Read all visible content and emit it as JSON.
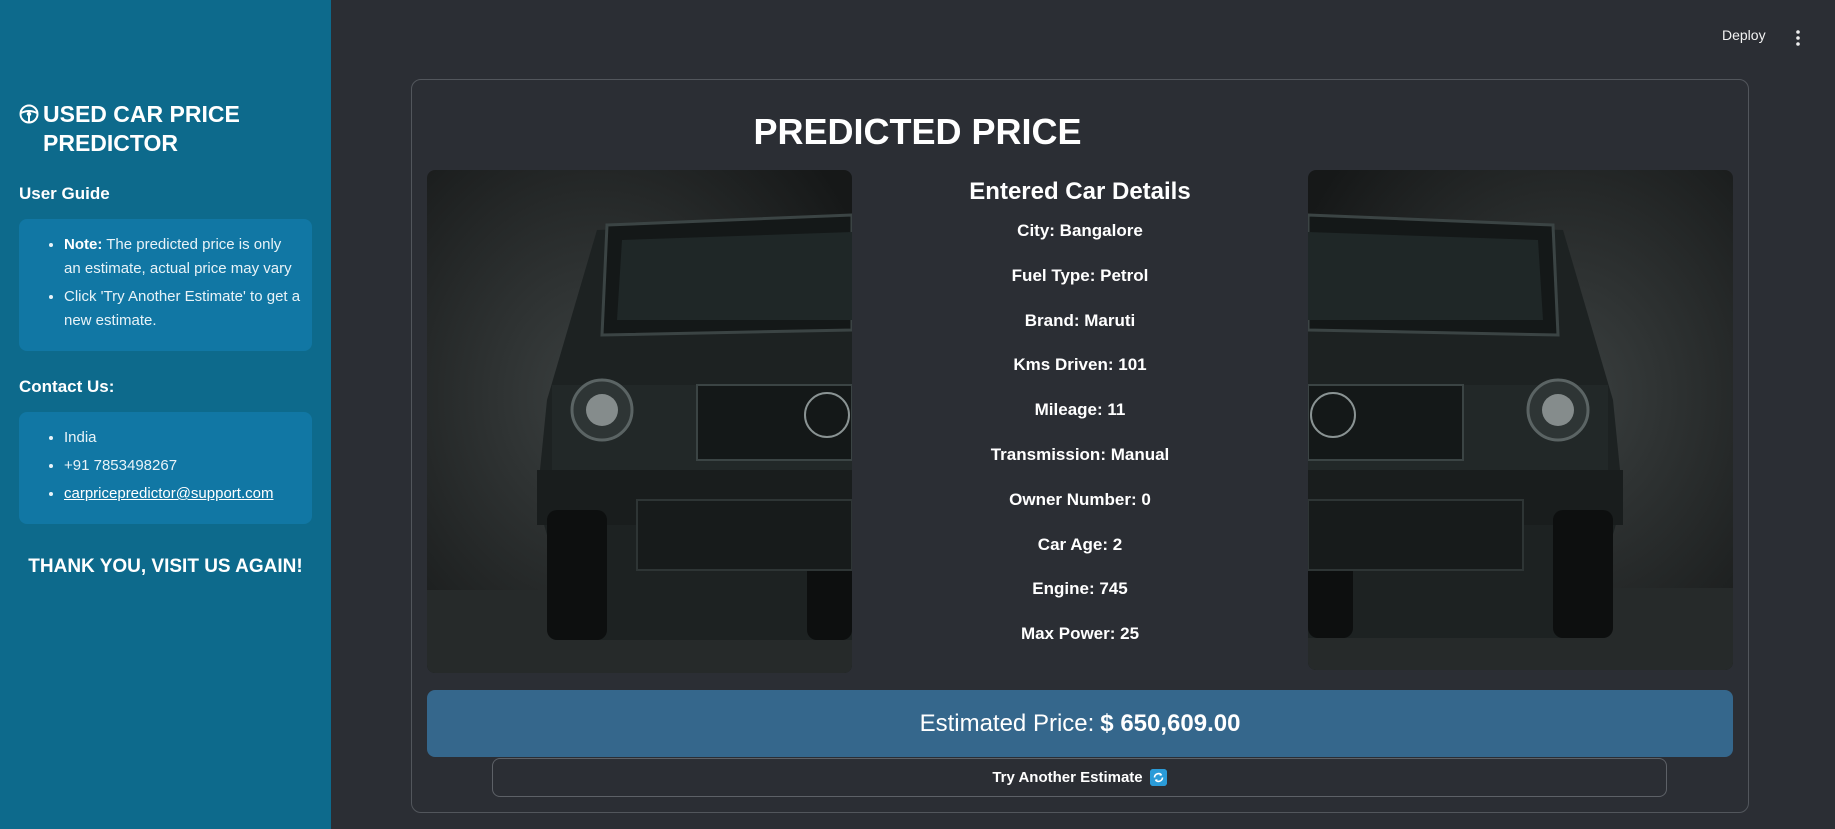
{
  "sidebar": {
    "title": "USED CAR PRICE PREDICTOR",
    "user_guide": {
      "heading": "User Guide",
      "note_label": "Note:",
      "note_text": " The predicted price is only an estimate, actual price may vary",
      "tip": "Click 'Try Another Estimate' to get a new estimate."
    },
    "contact": {
      "heading": "Contact Us:",
      "country": "India",
      "phone": "+91 7853498267",
      "email": "carpricepredictor@support.com"
    },
    "thanks": "THANK YOU, VISIT US AGAIN!"
  },
  "topbar": {
    "deploy": "Deploy",
    "menu_icon": "vertical-dots-icon"
  },
  "main": {
    "title": "PREDICTED PRICE",
    "details_heading": "Entered Car Details",
    "details": [
      "City: Bangalore",
      "Fuel Type: Petrol",
      "Brand: Maruti",
      "Kms Driven: 101",
      "Mileage: 11",
      "Transmission: Manual",
      "Owner Number: 0",
      "Car Age: 2",
      "Engine: 745",
      "Max Power: 25"
    ],
    "price_label": "Estimated Price:",
    "price_value": "$ 650,609.00",
    "retry_button": "Try Another Estimate"
  },
  "colors": {
    "sidebar_bg": "#0d6a8c",
    "sidebar_box": "#1177a4",
    "main_bg": "#2b2e34",
    "price_bar": "#35678c",
    "refresh_icon": "#2a9bd8"
  }
}
